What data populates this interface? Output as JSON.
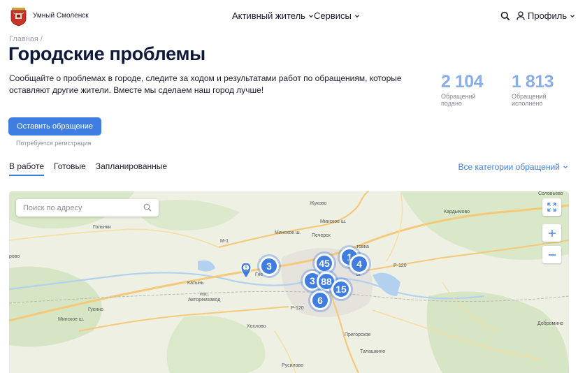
{
  "header": {
    "logo_text": "Умный Смоленск",
    "nav": [
      {
        "label": "Активный житель"
      },
      {
        "label": "Сервисы"
      }
    ],
    "profile_label": "Профиль"
  },
  "breadcrumb": "Главная /",
  "page": {
    "title": "Городские проблемы",
    "description": "Сообщайте о проблемах в городе, следите за ходом и результатами работ по обращениям, которые оставляют другие жители. Вместе мы сделаем наш город лучше!"
  },
  "stats": [
    {
      "value": "2 104",
      "label": "Обращений подано"
    },
    {
      "value": "1 813",
      "label": "Обращений исполнено"
    }
  ],
  "cta": {
    "label": "Оставить обращение",
    "note": "Потребуется регистрация"
  },
  "tabs": [
    {
      "label": "В работе",
      "active": true
    },
    {
      "label": "Готовые",
      "active": false
    },
    {
      "label": "Запланированные",
      "active": false
    }
  ],
  "category_filter": "Все категории обращений",
  "map": {
    "search_placeholder": "Поиск по адресу",
    "labels": {
      "zhukovo": "Жуково",
      "solovyevo": "Соловьево",
      "kardymovo": "Кардымово",
      "golynki": "Гольнки",
      "rovo": "рово",
      "minskoe_sh1": "Минское ш.",
      "minskoe_sh2": "Минское ш.",
      "minskoe_sh3": "Минское ш.",
      "m1": "М-1",
      "pechersk": "Печерск",
      "katyn": "Катынь",
      "pos": "пос.",
      "avtoremzavod": "Авторемзавод",
      "gusino": "Гусино",
      "khokhlovo": "Хохлово",
      "prigorskoe": "Пригорское",
      "talashkino": "Талашкино",
      "rusilovo": "Русилово",
      "dobromino": "Добромино",
      "p120a": "Р-120",
      "p120b": "Р-120",
      "gne": "Гне",
      "ovka": "товка",
      "sk": "ск"
    },
    "clusters": [
      {
        "count": "3"
      },
      {
        "count": "45"
      },
      {
        "count": "1"
      },
      {
        "count": "4"
      },
      {
        "count": "3"
      },
      {
        "count": "88"
      },
      {
        "count": "15"
      },
      {
        "count": "6"
      }
    ]
  },
  "colors": {
    "accent": "#3f7ee0",
    "stat_number": "#8aaee6",
    "title": "#0f1a3a"
  },
  "icons": [
    "coat-of-arms-icon",
    "chevron-down-icon",
    "search-icon",
    "user-icon",
    "fullscreen-icon",
    "plus-icon",
    "minus-icon",
    "alert-pin-icon"
  ]
}
